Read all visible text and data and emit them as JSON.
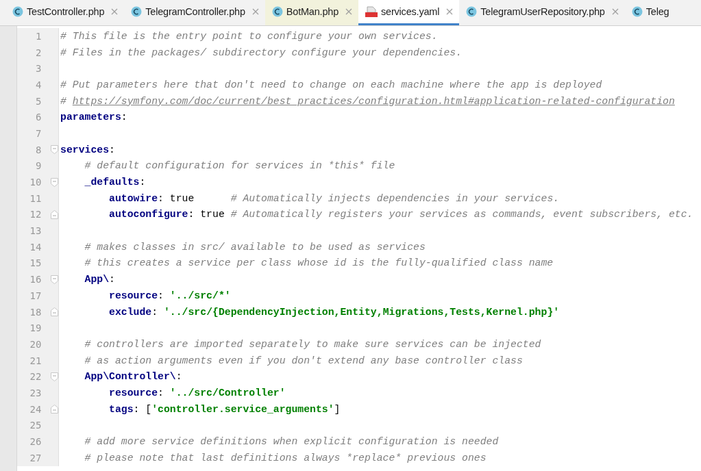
{
  "tabs": [
    {
      "label": "TestController.php",
      "kind": "php",
      "selected": false,
      "highlighted": false,
      "closable": true
    },
    {
      "label": "TelegramController.php",
      "kind": "php",
      "selected": false,
      "highlighted": false,
      "closable": true
    },
    {
      "label": "BotMan.php",
      "kind": "php",
      "selected": false,
      "highlighted": true,
      "closable": true
    },
    {
      "label": "services.yaml",
      "kind": "yaml",
      "selected": true,
      "highlighted": false,
      "closable": true
    },
    {
      "label": "TelegramUserRepository.php",
      "kind": "php",
      "selected": false,
      "highlighted": false,
      "closable": true
    },
    {
      "label": "Teleg",
      "kind": "php",
      "selected": false,
      "highlighted": false,
      "closable": false
    }
  ],
  "lines": [
    {
      "number": "1",
      "kind": "plain",
      "tokens": [
        {
          "kind": "comment",
          "text": "# This file is the entry point to configure your own services."
        }
      ]
    },
    {
      "number": "2",
      "kind": "plain",
      "tokens": [
        {
          "kind": "comment",
          "text": "# Files in the packages/ subdirectory configure your dependencies."
        }
      ]
    },
    {
      "number": "3",
      "kind": "plain"
    },
    {
      "number": "4",
      "kind": "plain",
      "tokens": [
        {
          "kind": "comment",
          "text": "# Put parameters here that don't need to change on each machine where the app is deployed"
        }
      ]
    },
    {
      "number": "5",
      "kind": "plain",
      "tokens": [
        {
          "kind": "comment",
          "text": "# "
        },
        {
          "kind": "link",
          "text": "https://symfony.com/doc/current/best_practices/configuration.html#application-related-configuration"
        }
      ]
    },
    {
      "number": "6",
      "kind": "plain",
      "tokens": [
        {
          "kind": "key",
          "text": "parameters"
        },
        {
          "kind": "plain",
          "text": ":"
        }
      ]
    },
    {
      "number": "7",
      "kind": "plain"
    },
    {
      "number": "8",
      "kind": "fold-start",
      "tokens": [
        {
          "kind": "key",
          "text": "services"
        },
        {
          "kind": "plain",
          "text": ":"
        }
      ]
    },
    {
      "number": "9",
      "kind": "plain",
      "tokens": [
        {
          "kind": "comment",
          "text": "    # default configuration for services in *this* file"
        }
      ]
    },
    {
      "number": "10",
      "kind": "fold-start",
      "tokens": [
        {
          "kind": "key",
          "text": "    _defaults"
        },
        {
          "kind": "plain",
          "text": ":"
        }
      ]
    },
    {
      "number": "11",
      "kind": "plain",
      "tokens": [
        {
          "kind": "key",
          "text": "        autowire"
        },
        {
          "kind": "plain",
          "text": ": true      "
        },
        {
          "kind": "comment",
          "text": "# Automatically injects dependencies in your services."
        }
      ]
    },
    {
      "number": "12",
      "kind": "fold-end",
      "tokens": [
        {
          "kind": "key",
          "text": "        autoconfigure"
        },
        {
          "kind": "plain",
          "text": ": true "
        },
        {
          "kind": "comment",
          "text": "# Automatically registers your services as commands, event subscribers, etc."
        }
      ]
    },
    {
      "number": "13",
      "kind": "plain"
    },
    {
      "number": "14",
      "kind": "plain",
      "tokens": [
        {
          "kind": "comment",
          "text": "    # makes classes in src/ available to be used as services"
        }
      ]
    },
    {
      "number": "15",
      "kind": "plain",
      "tokens": [
        {
          "kind": "comment",
          "text": "    # this creates a service per class whose id is the fully-qualified class name"
        }
      ]
    },
    {
      "number": "16",
      "kind": "fold-start",
      "tokens": [
        {
          "kind": "key",
          "text": "    App\\"
        },
        {
          "kind": "plain",
          "text": ":"
        }
      ]
    },
    {
      "number": "17",
      "kind": "plain",
      "tokens": [
        {
          "kind": "key",
          "text": "        resource"
        },
        {
          "kind": "plain",
          "text": ": "
        },
        {
          "kind": "string",
          "text": "'../src/*'"
        }
      ]
    },
    {
      "number": "18",
      "kind": "fold-end",
      "tokens": [
        {
          "kind": "key",
          "text": "        exclude"
        },
        {
          "kind": "plain",
          "text": ": "
        },
        {
          "kind": "string",
          "text": "'../src/{DependencyInjection,Entity,Migrations,Tests,Kernel.php}'"
        }
      ]
    },
    {
      "number": "19",
      "kind": "plain"
    },
    {
      "number": "20",
      "kind": "plain",
      "tokens": [
        {
          "kind": "comment",
          "text": "    # controllers are imported separately to make sure services can be injected"
        }
      ]
    },
    {
      "number": "21",
      "kind": "plain",
      "tokens": [
        {
          "kind": "comment",
          "text": "    # as action arguments even if you don't extend any base controller class"
        }
      ]
    },
    {
      "number": "22",
      "kind": "fold-start",
      "tokens": [
        {
          "kind": "key",
          "text": "    App\\Controller\\"
        },
        {
          "kind": "plain",
          "text": ":"
        }
      ]
    },
    {
      "number": "23",
      "kind": "plain",
      "tokens": [
        {
          "kind": "key",
          "text": "        resource"
        },
        {
          "kind": "plain",
          "text": ": "
        },
        {
          "kind": "string",
          "text": "'../src/Controller'"
        }
      ]
    },
    {
      "number": "24",
      "kind": "fold-end",
      "tokens": [
        {
          "kind": "key",
          "text": "        tags"
        },
        {
          "kind": "plain",
          "text": ": ["
        },
        {
          "kind": "string",
          "text": "'controller.service_arguments'"
        },
        {
          "kind": "plain",
          "text": "]"
        }
      ]
    },
    {
      "number": "25",
      "kind": "plain"
    },
    {
      "number": "26",
      "kind": "plain",
      "tokens": [
        {
          "kind": "comment",
          "text": "    # add more service definitions when explicit configuration is needed"
        }
      ]
    },
    {
      "number": "27",
      "kind": "plain",
      "tokens": [
        {
          "kind": "comment",
          "text": "    # please note that last definitions always *replace* previous ones"
        }
      ]
    }
  ]
}
